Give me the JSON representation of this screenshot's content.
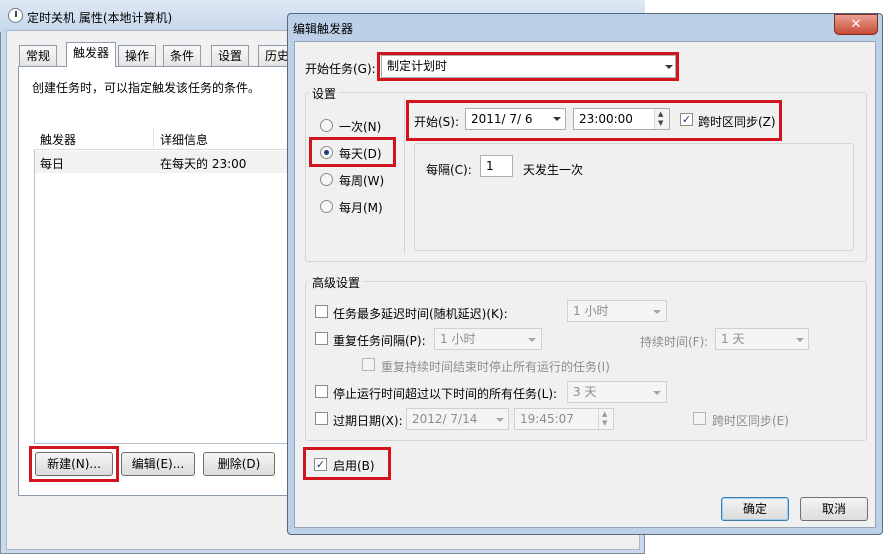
{
  "bg_window": {
    "title": "定时关机 属性(本地计算机)",
    "tabs": [
      "常规",
      "触发器",
      "操作",
      "条件",
      "设置",
      "历史"
    ],
    "description": "创建任务时，可以指定触发该任务的条件。",
    "table": {
      "headers": [
        "触发器",
        "详细信息"
      ],
      "rows": [
        [
          "每日",
          "在每天的 23:00"
        ]
      ]
    },
    "buttons": {
      "new": "新建(N)...",
      "edit": "编辑(E)...",
      "delete": "删除(D)"
    }
  },
  "dialog": {
    "title": "编辑触发器",
    "close_glyph": "✕",
    "start_task_label": "开始任务(G):",
    "start_task_value": "制定计划时",
    "settings_group": "设置",
    "schedule_options": [
      "一次(N)",
      "每天(D)",
      "每周(W)",
      "每月(M)"
    ],
    "selected_schedule": "每天(D)",
    "start_label": "开始(S):",
    "start_date": "2011/  7/  6",
    "start_time": "23:00:00",
    "sync_timezone": "跨时区同步(Z)",
    "recur_label": "每隔(C):",
    "recur_value": "1",
    "recur_suffix": "天发生一次",
    "advanced_group": "高级设置",
    "delay_label": "任务最多延迟时间(随机延迟)(K):",
    "delay_value": "1 小时",
    "repeat_label": "重复任务间隔(P):",
    "repeat_value": "1 小时",
    "duration_label": "持续时间(F):",
    "duration_value": "1 天",
    "stop_repeat_label": "重复持续时间结束时停止所有运行的任务(I)",
    "stop_long_label": "停止运行时间超过以下时间的所有任务(L):",
    "stop_long_value": "3 天",
    "expire_label": "过期日期(X):",
    "expire_date": "2012/  7/14",
    "expire_time": "19:45:07",
    "expire_sync": "跨时区同步(E)",
    "enabled_label": "启用(B)",
    "ok": "确定",
    "cancel": "取消",
    "check_glyph": "✓"
  },
  "colors": {
    "highlight": "#d3141d",
    "title_bar": "#bcd0e8"
  }
}
